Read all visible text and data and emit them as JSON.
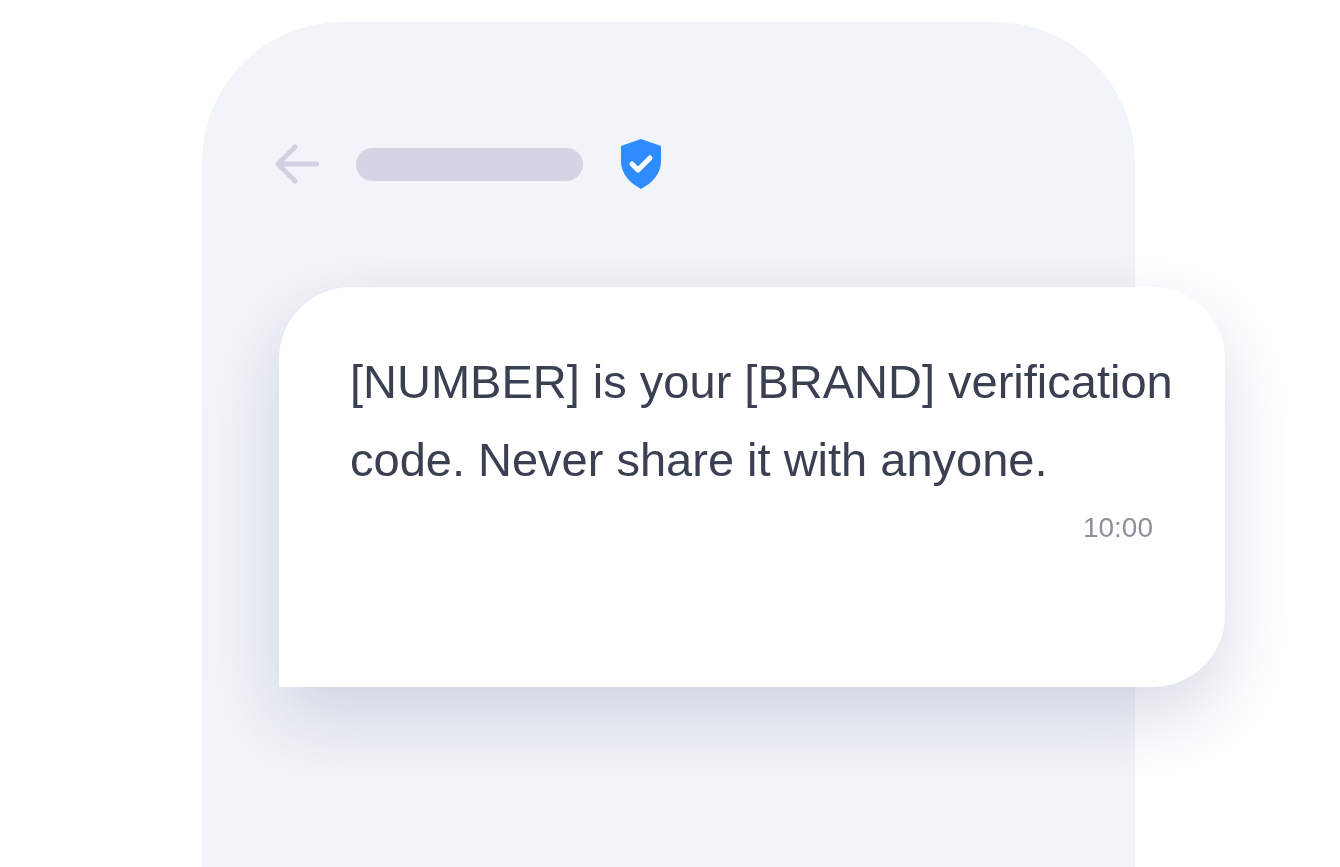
{
  "message": {
    "text": "[NUMBER] is your [BRAND] verification code. Never share it with anyone.",
    "time": "10:00"
  }
}
